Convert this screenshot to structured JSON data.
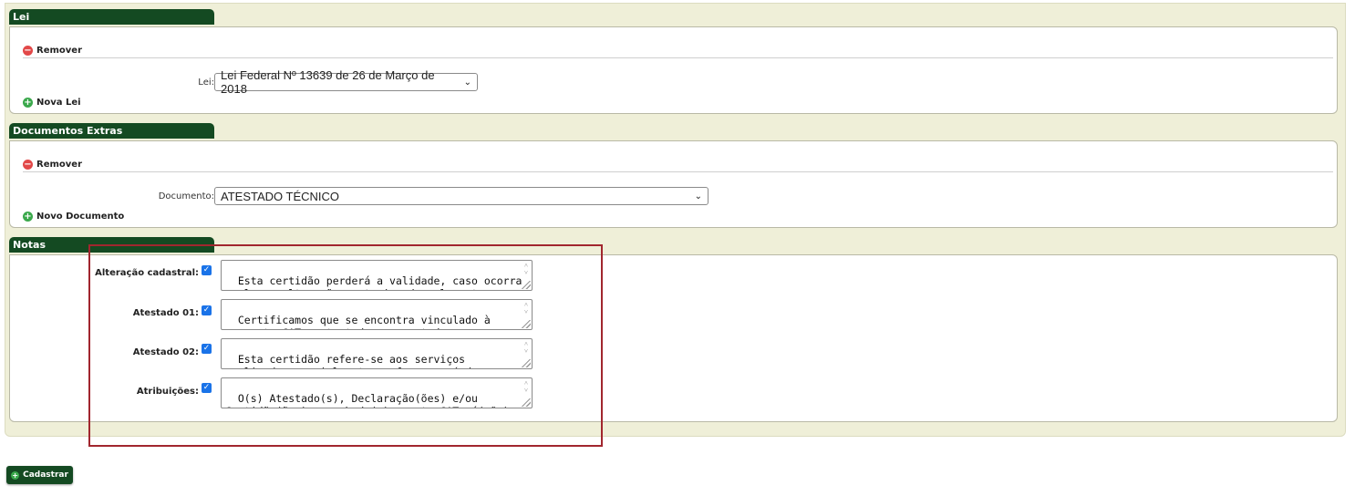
{
  "lei": {
    "title": "Lei",
    "remove_label": "Remover",
    "field_label": "Lei:",
    "selected": "Lei Federal Nº 13639 de 26 de Março de 2018",
    "add_label": "Nova Lei"
  },
  "docs": {
    "title": "Documentos Extras",
    "remove_label": "Remover",
    "field_label": "Documento:",
    "selected": "ATESTADO TÉCNICO",
    "add_label": "Novo Documento"
  },
  "notas": {
    "title": "Notas",
    "items": [
      {
        "label": "Alteração cadastral:",
        "checked": true,
        "text": "Esta certidão perderá a validade, caso ocorra\nqualquer alteração posterior dos elementos"
      },
      {
        "label": "Atestado 01:",
        "checked": true,
        "text": "Certificamos que se encontra vinculado à\npresente CAT o atestado apresentado em"
      },
      {
        "label": "Atestado 02:",
        "checked": true,
        "text": "Esta certidão refere-se aos serviços\nrealizados parcialmente conforme período ou"
      },
      {
        "label": "Atribuições:",
        "checked": true,
        "text": "O(s) Atestado(s), Declaração(ões) e/ou\nCertidão(ões), averbada(s) a esta CAT, é(são)"
      }
    ]
  },
  "submit_label": "Cadastrar",
  "colors": {
    "header_green": "#144a22",
    "highlight_red": "#a1262e",
    "checkbox_blue": "#1a73e8"
  }
}
